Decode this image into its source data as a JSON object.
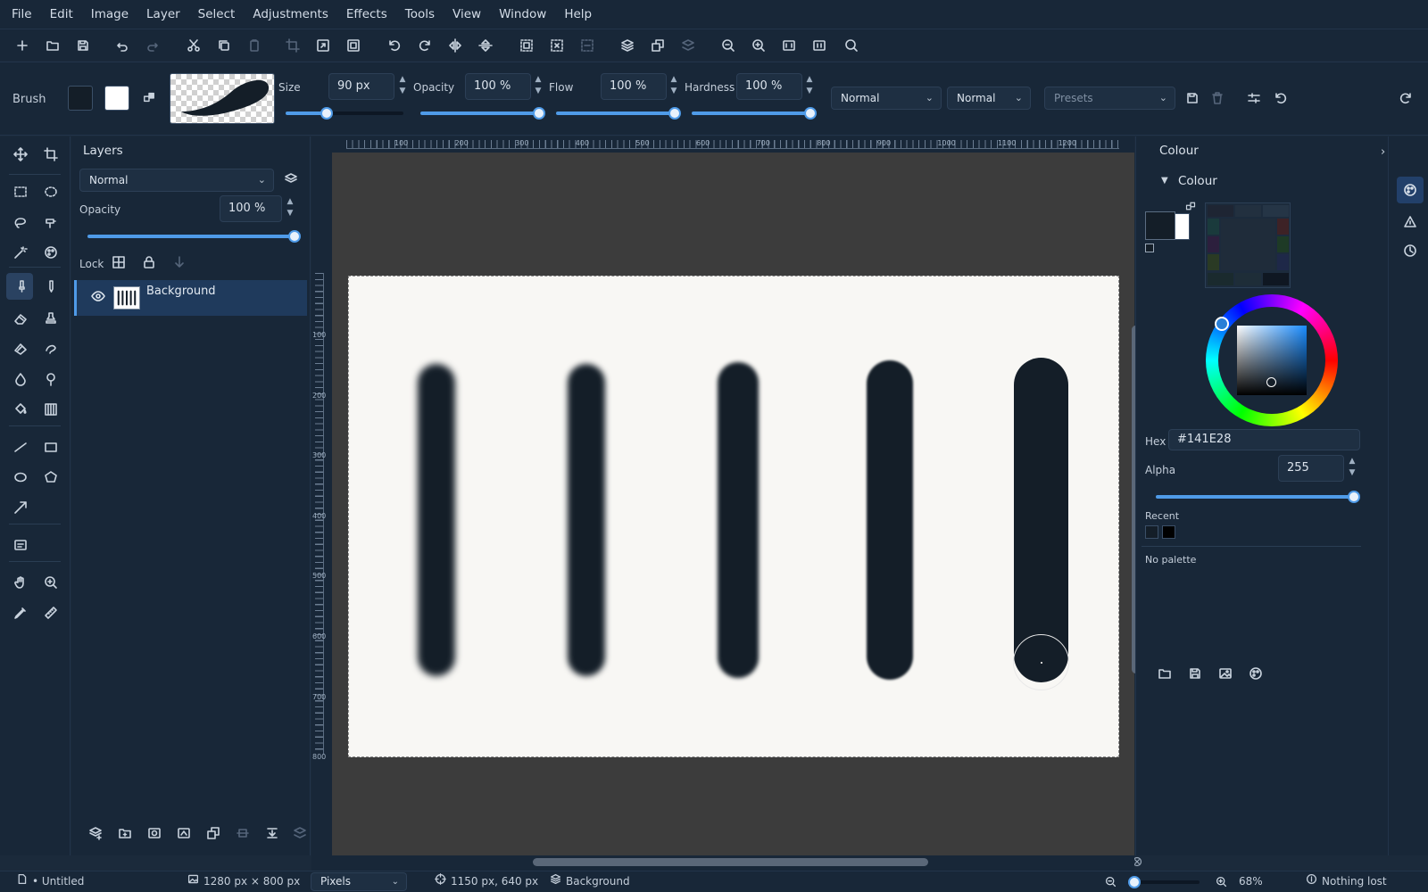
{
  "menubar": [
    "File",
    "Edit",
    "Image",
    "Layer",
    "Select",
    "Adjustments",
    "Effects",
    "Tools",
    "View",
    "Window",
    "Help"
  ],
  "options": {
    "tool_name": "Brush",
    "size_label": "Size",
    "size_value": "90 px",
    "opacity_label": "Opacity",
    "opacity_value": "100 %",
    "flow_label": "Flow",
    "flow_value": "100 %",
    "hardness_label": "Hardness",
    "hardness_value": "100 %",
    "blend_mode_1": "Normal",
    "blend_mode_2": "Normal",
    "presets_placeholder": "Presets",
    "size_slider_fraction": 0.34,
    "opacity_fraction": 1.0,
    "flow_fraction": 1.0,
    "hardness_fraction": 1.0
  },
  "layers_panel": {
    "title": "Layers",
    "blend_mode": "Normal",
    "opacity_label": "Opacity",
    "opacity_value": "100 %",
    "opacity_fraction": 1.0,
    "lock_label": "Lock",
    "layers": [
      {
        "name": "Background",
        "visible": true,
        "selected": true
      }
    ]
  },
  "rulers": {
    "top": [
      "100",
      "200",
      "300",
      "400",
      "500",
      "600",
      "700",
      "800",
      "900",
      "1000",
      "1100",
      "1200"
    ],
    "left": [
      "100",
      "200",
      "300",
      "400",
      "500",
      "600",
      "700",
      "800"
    ]
  },
  "colour_panel": {
    "title": "Colour",
    "section": "Colour",
    "primary_color": "#141E28",
    "secondary_color": "#FFFFFF",
    "hex_label": "Hex",
    "hex_value": "#141E28",
    "alpha_label": "Alpha",
    "alpha_value": "255",
    "alpha_fraction": 1.0,
    "recent_label": "Recent",
    "recent_colors": [
      "#141E28",
      "#000000"
    ],
    "palette_text": "No palette"
  },
  "statusbar": {
    "document": "• Untitled",
    "image_size": "1280 px × 800 px",
    "units": "Pixels",
    "cursor_position": "1150 px, 640 px",
    "active_layer": "Background",
    "zoom": "68%",
    "saved_state": "Nothing lost"
  },
  "colors": {
    "accent": "#4F9BE8",
    "panel_bg": "#182738",
    "canvas_bg": "#3C3C3C",
    "document_bg": "#F8F7F4",
    "stroke": "#141E28"
  }
}
